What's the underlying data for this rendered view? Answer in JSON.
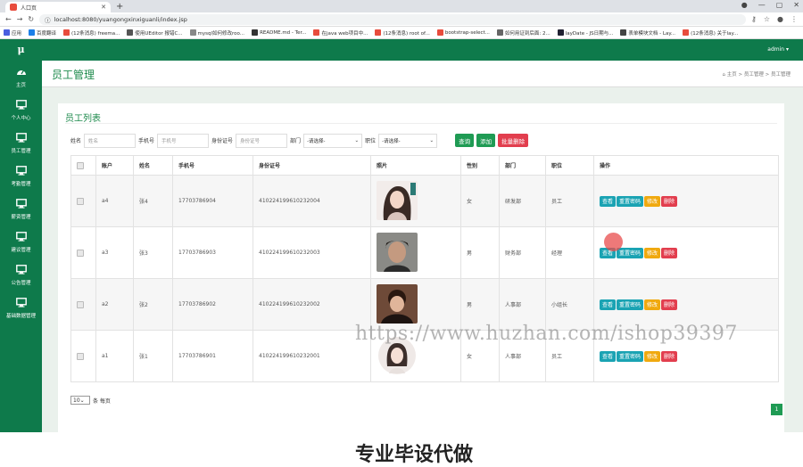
{
  "browser": {
    "tab_title": "人口页",
    "url": "localhost:8080/yuangongxinxiguanli/index.jsp",
    "bookmarks": [
      "应用",
      "百度翻译",
      "(12条消息) freema...",
      "使用UEditor 报错C...",
      "mysql如何修改roo...",
      "README.md - Ter...",
      "在java web项目中...",
      "(12条消息) root of...",
      "bootstrap-select...",
      "如何用证到后面: 2...",
      "layDate - JS日期与...",
      "表单模块文档 - Lay...",
      "(12条消息) 关于lay..."
    ]
  },
  "sidebar": {
    "logo": "μ",
    "items": [
      {
        "label": "主页",
        "icon": "dashboard-icon"
      },
      {
        "label": "个人中心",
        "icon": "monitor-icon"
      },
      {
        "label": "员工管理",
        "icon": "monitor-icon"
      },
      {
        "label": "考勤管理",
        "icon": "monitor-icon"
      },
      {
        "label": "薪资管理",
        "icon": "monitor-icon"
      },
      {
        "label": "建议管理",
        "icon": "monitor-icon"
      },
      {
        "label": "公告管理",
        "icon": "monitor-icon"
      },
      {
        "label": "基础数据管理",
        "icon": "monitor-icon"
      }
    ]
  },
  "topbar": {
    "user": "admin ▾"
  },
  "page": {
    "title": "员工管理",
    "breadcrumb": [
      "⌂ 主页",
      "员工管理",
      "员工管理"
    ]
  },
  "list": {
    "title": "员工列表",
    "filters": {
      "name_label": "姓名",
      "name_placeholder": "姓名",
      "phone_label": "手机号",
      "phone_placeholder": "手机号",
      "id_label": "身份证号",
      "id_placeholder": "身份证号",
      "dept_label": "部门",
      "dept_value": "-请选择-",
      "post_label": "职位",
      "post_value": "-请选择-"
    },
    "buttons": {
      "search": "查询",
      "add": "添加",
      "batch_delete": "批量删除"
    },
    "columns": [
      "账户",
      "姓名",
      "手机号",
      "身份证号",
      "照片",
      "性别",
      "部门",
      "职位",
      "操作"
    ],
    "rows": [
      {
        "account": "a4",
        "name": "张4",
        "phone": "17703786904",
        "idcard": "410224199610232004",
        "gender": "女",
        "dept": "研发部",
        "post": "员工"
      },
      {
        "account": "a3",
        "name": "张3",
        "phone": "17703786903",
        "idcard": "410224199610232003",
        "gender": "男",
        "dept": "财务部",
        "post": "经理"
      },
      {
        "account": "a2",
        "name": "张2",
        "phone": "17703786902",
        "idcard": "410224199610232002",
        "gender": "男",
        "dept": "人事部",
        "post": "小组长"
      },
      {
        "account": "a1",
        "name": "张1",
        "phone": "17703786901",
        "idcard": "410224199610232001",
        "gender": "女",
        "dept": "人事部",
        "post": "员工"
      }
    ],
    "row_actions": {
      "view": "查看",
      "reset": "重置密码",
      "edit": "修改",
      "delete": "删除"
    },
    "page_size": "10",
    "page_size_suffix": "条 每页",
    "current_page": "1"
  },
  "overlay": {
    "watermark": "https://www.huzhan.com/ishop39397",
    "banner": "专业毕设代做"
  },
  "colors": {
    "sidebar": "#0e7a4b",
    "accent": "#1d8a4c",
    "danger": "#e23e4e",
    "info": "#1aa3b3",
    "warning": "#f0a90f"
  }
}
